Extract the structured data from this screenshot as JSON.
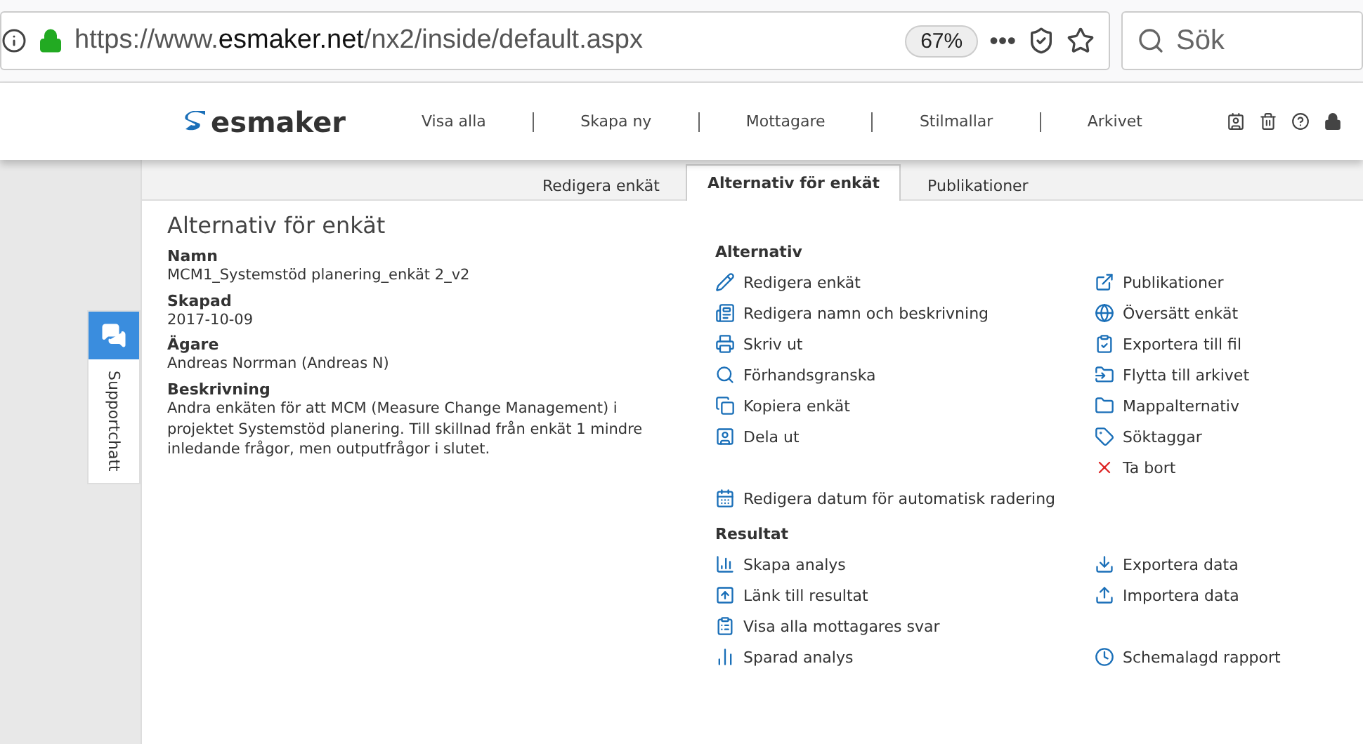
{
  "browser": {
    "url_prefix": "https://www.",
    "url_domain": "esmaker.net",
    "url_path": "/nx2/inside/default.aspx",
    "zoom": "67%",
    "menu": "•••",
    "search_placeholder": "Sök"
  },
  "header": {
    "logo": "esmaker",
    "nav": [
      "Visa alla",
      "Skapa ny",
      "Mottagare",
      "Stilmallar",
      "Arkivet"
    ]
  },
  "tabs": [
    {
      "label": "Redigera enkät",
      "selected": false
    },
    {
      "label": "Alternativ för enkät",
      "selected": true
    },
    {
      "label": "Publikationer",
      "selected": false
    }
  ],
  "page_title": "Alternativ för enkät",
  "details": [
    {
      "label": "Namn",
      "value": "MCM1_Systemstöd planering_enkät 2_v2"
    },
    {
      "label": "Skapad",
      "value": "2017-10-09"
    },
    {
      "label": "Ägare",
      "value": "Andreas Norrman (Andreas N)"
    },
    {
      "label": "Beskrivning",
      "value": "Andra enkäten för att MCM (Measure Change Management) i projektet Systemstöd planering. Till skillnad från enkät 1 mindre inledande frågor, men outputfrågor i slutet."
    }
  ],
  "options": {
    "heading": "Alternativ",
    "left": [
      "Redigera enkät",
      "Redigera namn och beskrivning",
      "Skriv ut",
      "Förhandsgranska",
      "Kopiera enkät",
      "Dela ut"
    ],
    "right": [
      "Publikationer",
      "Översätt enkät",
      "Exportera till fil",
      "Flytta till arkivet",
      "Mappalternativ",
      "Söktaggar",
      "Ta bort"
    ],
    "extra": "Redigera datum för automatisk radering"
  },
  "results": {
    "heading": "Resultat",
    "left": [
      "Skapa analys",
      "Länk till resultat",
      "Visa alla mottagares svar",
      "Sparad analys"
    ],
    "right": [
      "Exportera data",
      "Importera data"
    ],
    "right_extra": "Schemalagd rapport"
  },
  "support": "Supportchatt"
}
